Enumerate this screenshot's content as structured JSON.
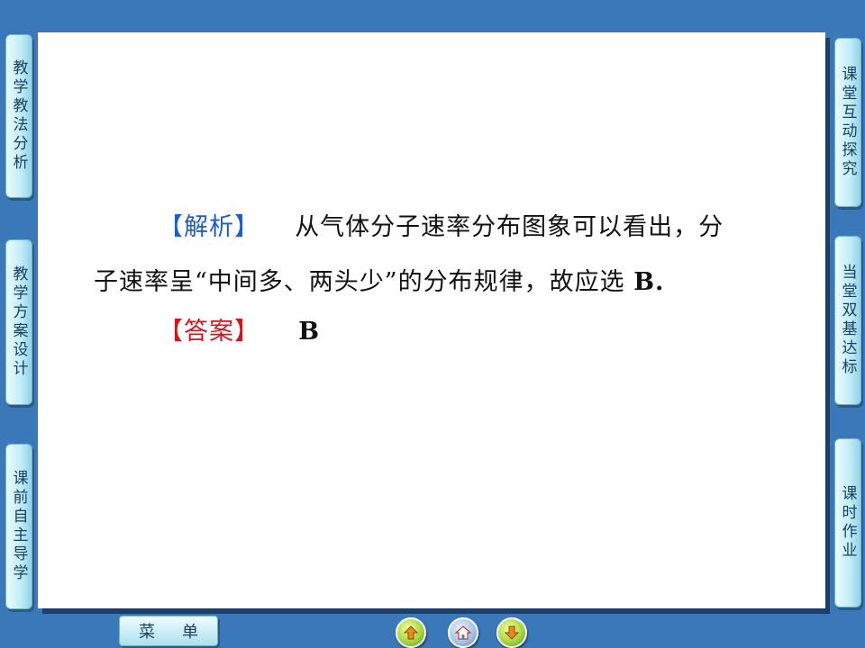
{
  "left_tabs": [
    {
      "label": "教学教法分析"
    },
    {
      "label": "教学方案设计"
    },
    {
      "label": "课前自主导学"
    }
  ],
  "right_tabs": [
    {
      "label": "课堂互动探究"
    },
    {
      "label": "当堂双基达标"
    },
    {
      "label": "课时作业"
    }
  ],
  "content": {
    "analysis_label": "【解析】",
    "analysis_line1": "从气体分子速率分布图象可以看出，分",
    "analysis_line2": "子速率呈“中间多、两头少”的分布规律，故应选",
    "analysis_choice": "B.",
    "answer_label": "【答案】",
    "answer_value": "B"
  },
  "bottom_bar": {
    "menu_label": "菜单",
    "prev_icon": "up-arrow-icon",
    "home_icon": "home-icon",
    "next_icon": "down-arrow-icon"
  },
  "colors": {
    "background": "#3b78b9",
    "analysis_label": "#1f5fc4",
    "answer_label": "#d0161e"
  }
}
